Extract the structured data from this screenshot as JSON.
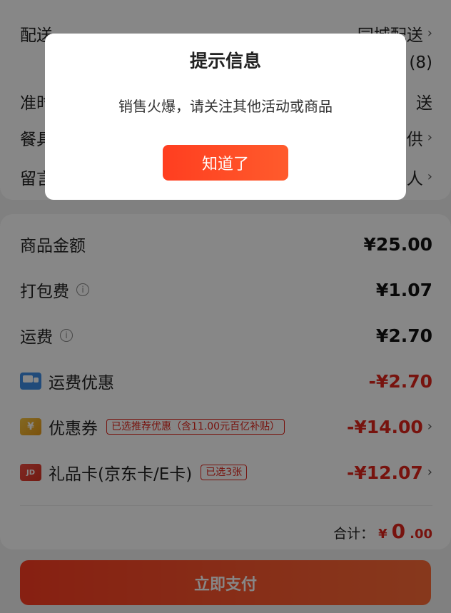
{
  "top_rows": [
    {
      "label": "配送",
      "value": "同城配送",
      "extra": "(8)"
    },
    {
      "label": "准时",
      "value": "送"
    },
    {
      "label": "餐具",
      "value": "供"
    },
    {
      "label": "留言",
      "value": "人"
    }
  ],
  "summary": {
    "goods_amount_label": "商品金额",
    "goods_amount_value": "¥25.00",
    "packing_fee_label": "打包费",
    "packing_fee_value": "¥1.07",
    "delivery_fee_label": "运费",
    "delivery_fee_value": "¥2.70",
    "delivery_discount_label": "运费优惠",
    "delivery_discount_value": "-¥2.70",
    "coupon_label": "优惠券",
    "coupon_badge": "已选推荐优惠（含11.00元百亿补贴）",
    "coupon_value": "-¥14.00",
    "gift_card_label": "礼品卡(京东卡/E卡)",
    "gift_card_badge": "已选3张",
    "gift_card_value": "-¥12.07",
    "total_label": "合计：",
    "total_symbol": "¥",
    "total_value": "0",
    "total_decimal": ".00",
    "pay_button_label": "立即支付"
  },
  "icons": {
    "info": "i",
    "arrow": "›",
    "coupon": "¥",
    "gift": "JD"
  },
  "dialog": {
    "title": "提示信息",
    "message": "销售火爆，请关注其他活动或商品",
    "button_label": "知道了"
  },
  "colors": {
    "accent": "#e1251b",
    "button_gradient_start": "#ff3d22",
    "button_gradient_end": "#ff6b36",
    "overlay": "#00000078"
  }
}
